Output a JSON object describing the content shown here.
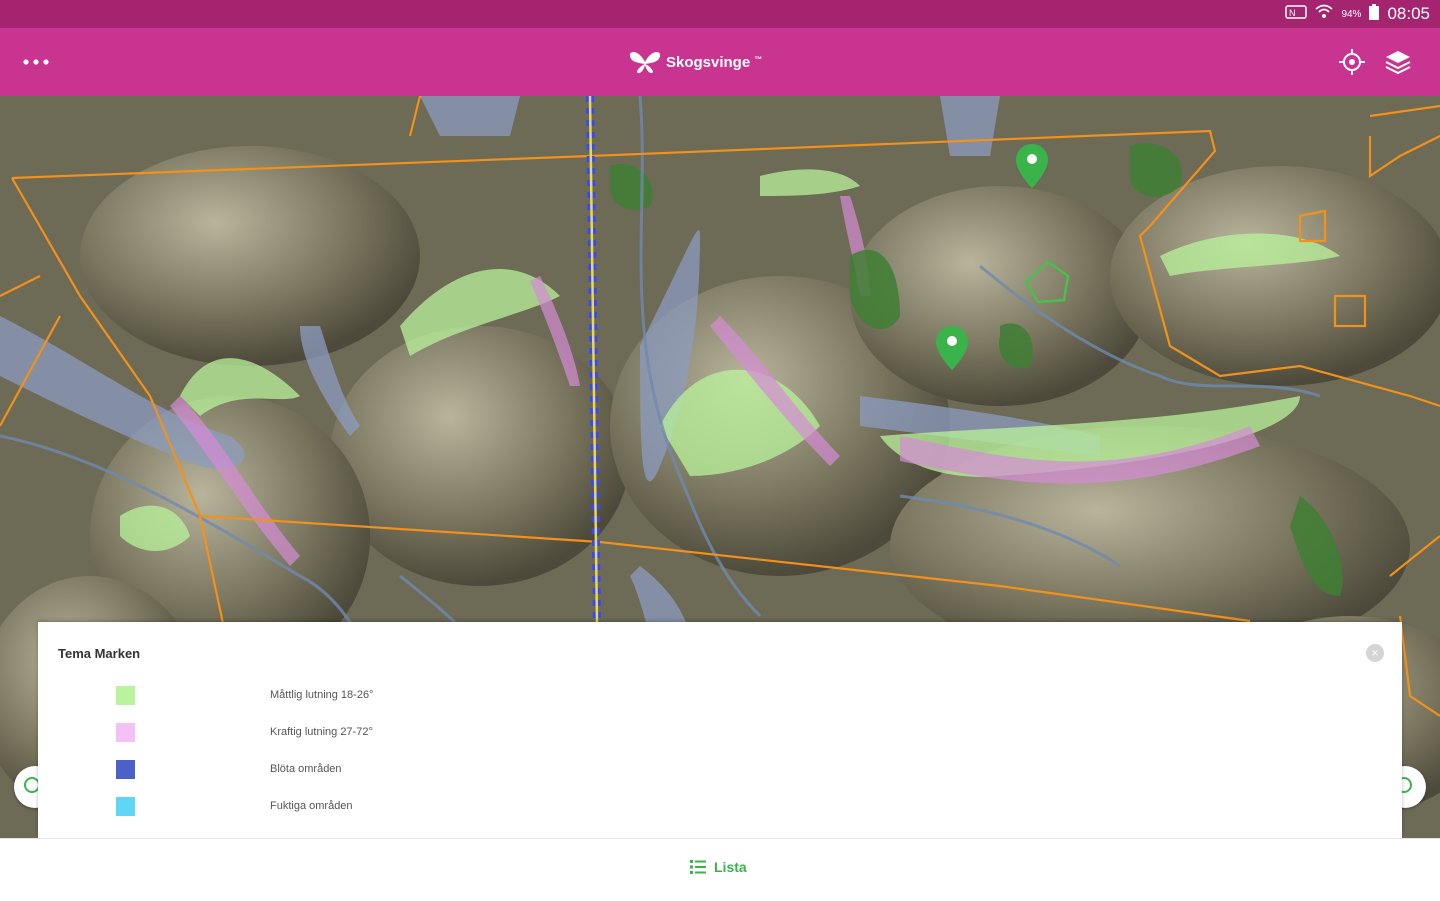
{
  "status_bar": {
    "battery": "94%",
    "time": "08:05"
  },
  "app_bar": {
    "logo_text": "Skogsvinge",
    "logo_tm": "™",
    "menu_icon": "more-horiz-icon",
    "locate_icon": "my-location-icon",
    "layers_icon": "layers-icon"
  },
  "colors": {
    "status_bar": "#a5246f",
    "app_bar": "#c8348f",
    "accent_green": "#3ab34a",
    "boundary_orange": "#f2911b"
  },
  "legend": {
    "title": "Tema Marken",
    "close_icon": "close-icon",
    "items": [
      {
        "label": "Måttlig lutning 18-26°",
        "color": "#b9f39b"
      },
      {
        "label": "Kraftig lutning 27-72°",
        "color": "#f5c0f3"
      },
      {
        "label": "Blöta områden",
        "color": "#4a62c8"
      },
      {
        "label": "Fuktiga områden",
        "color": "#5fd6f5"
      }
    ]
  },
  "bottom_bar": {
    "list_label": "Lista",
    "list_icon": "list-icon"
  }
}
